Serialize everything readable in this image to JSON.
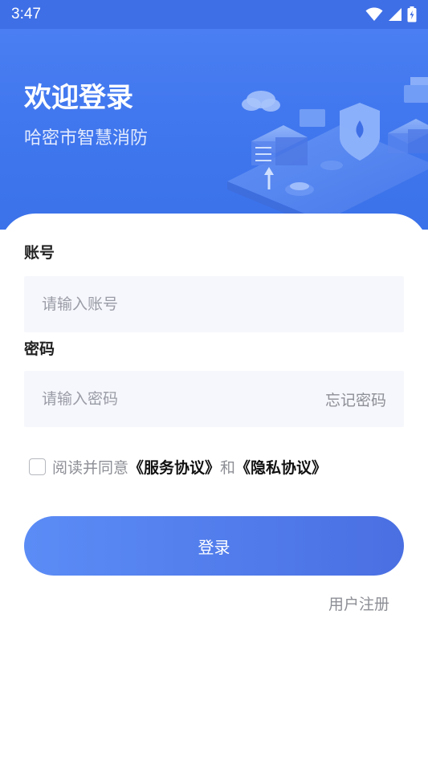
{
  "status_bar": {
    "time": "3:47",
    "icons": [
      "wifi-icon",
      "signal-icon",
      "battery-charging-icon"
    ]
  },
  "header": {
    "title": "欢迎登录",
    "subtitle": "哈密市智慧消防"
  },
  "form": {
    "account_label": "账号",
    "account_placeholder": "请输入账号",
    "account_value": "",
    "password_label": "密码",
    "password_placeholder": "请输入密码",
    "password_value": "",
    "forgot_password": "忘记密码"
  },
  "agreement": {
    "checked": false,
    "prefix": "阅读并同意",
    "service_link": "《服务协议》",
    "conjunction": "和",
    "privacy_link": "《隐私协议》"
  },
  "actions": {
    "login_label": "登录",
    "register_label": "用户注册"
  },
  "colors": {
    "brand_blue": "#3f76ee",
    "button_start": "#5b8cf6",
    "button_end": "#4a6fe2",
    "input_background": "#f6f7fc"
  }
}
